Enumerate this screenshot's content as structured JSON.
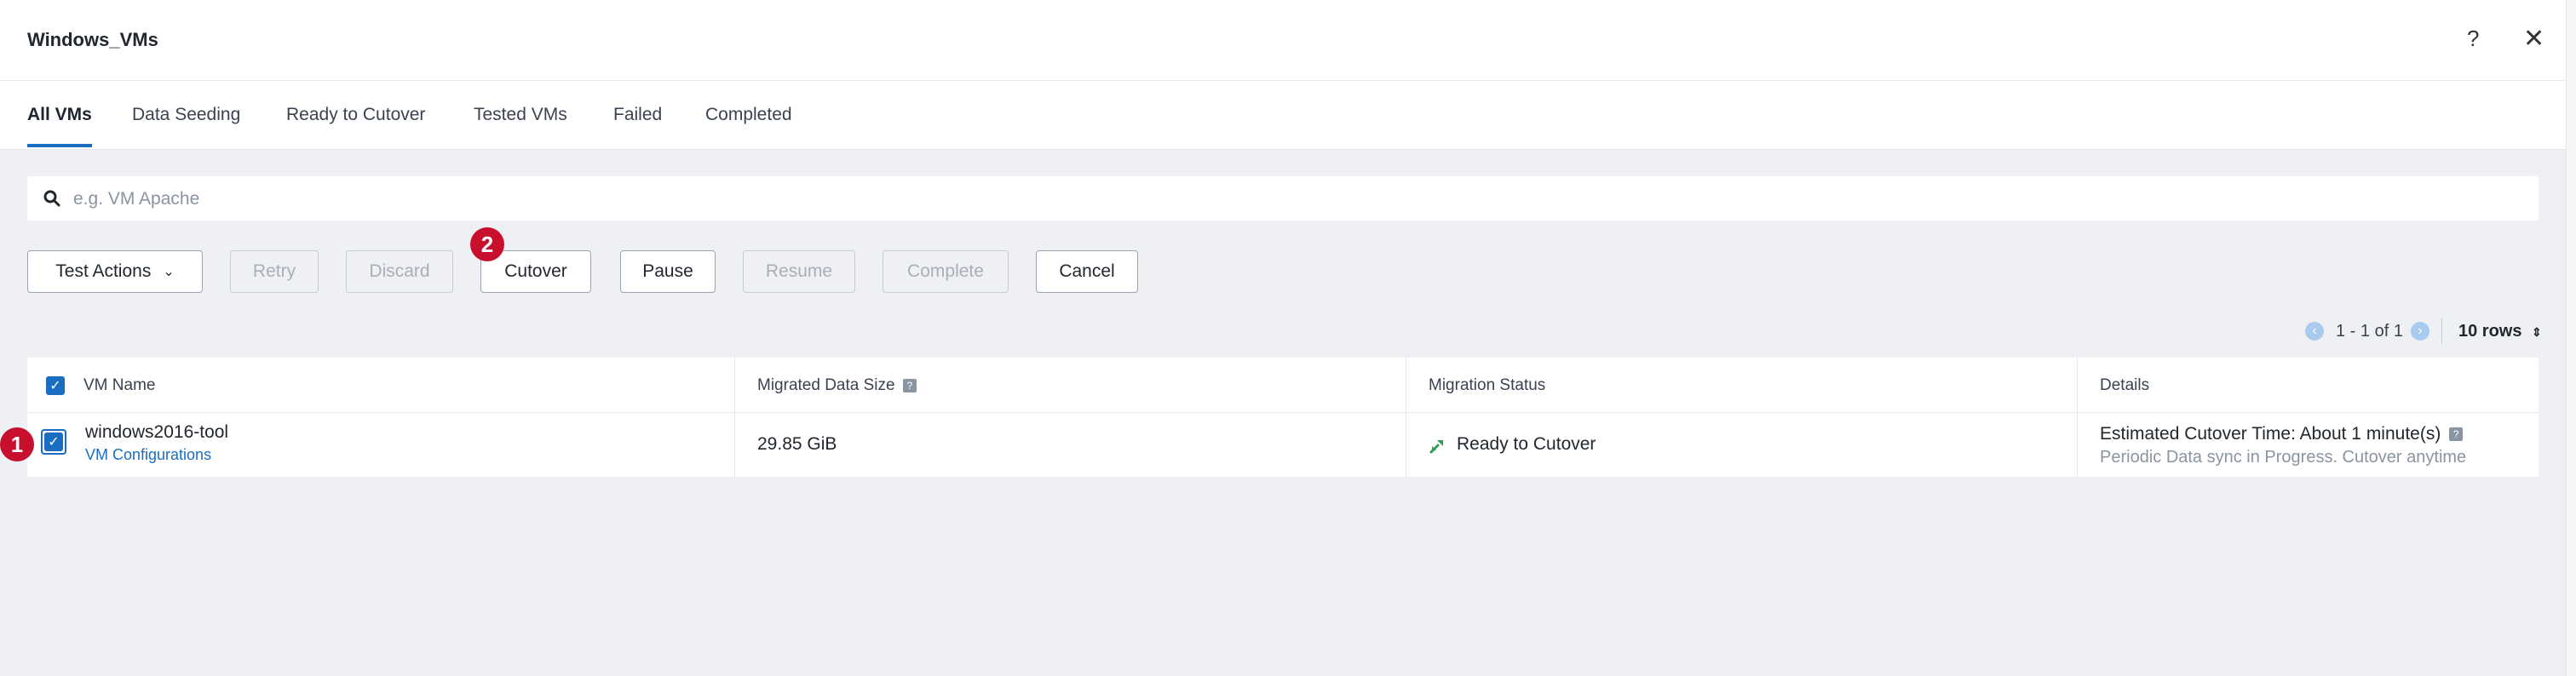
{
  "header": {
    "title": "Windows_VMs",
    "help_label": "?",
    "close_label": "✕"
  },
  "tabs": [
    {
      "label": "All VMs"
    },
    {
      "label": "Data Seeding"
    },
    {
      "label": "Ready to Cutover"
    },
    {
      "label": "Tested VMs"
    },
    {
      "label": "Failed"
    },
    {
      "label": "Completed"
    }
  ],
  "search": {
    "placeholder": "e.g. VM Apache",
    "value": ""
  },
  "toolbar": {
    "test_actions": "Test Actions",
    "retry": "Retry",
    "discard": "Discard",
    "cutover": "Cutover",
    "pause": "Pause",
    "resume": "Resume",
    "complete": "Complete",
    "cancel": "Cancel"
  },
  "annotations": {
    "badge_1": "1",
    "badge_2": "2"
  },
  "pagination": {
    "range": "1 - 1 of 1",
    "rows": "10 rows"
  },
  "table": {
    "columns": [
      "VM Name",
      "Migrated Data Size",
      "Migration Status",
      "Details"
    ],
    "rows": [
      {
        "vm_name": "windows2016-tool",
        "vm_link": "VM Configurations",
        "data_size": "29.85 GiB",
        "status": "Ready to Cutover",
        "details_main": "Estimated Cutover Time: About 1 minute(s)",
        "details_sub": "Periodic Data sync in Progress. Cutover anytime"
      }
    ]
  },
  "colors": {
    "accent": "#1b6dc1",
    "badge": "#c8102e",
    "status_green": "#2e9e4f"
  }
}
